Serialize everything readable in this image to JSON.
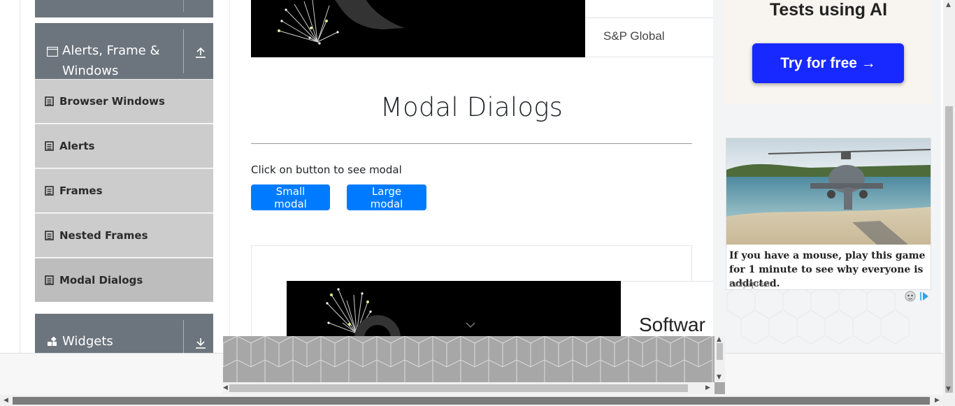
{
  "sidebar": {
    "group_alerts": {
      "title_line1": "Alerts, Frame &",
      "title_line2": "Windows",
      "icon": "window-icon",
      "toggle_icon": "arrow-up-icon"
    },
    "items": [
      {
        "label": "Browser Windows",
        "icon": "list-icon"
      },
      {
        "label": "Alerts",
        "icon": "list-icon"
      },
      {
        "label": "Frames",
        "icon": "list-icon"
      },
      {
        "label": "Nested Frames",
        "icon": "list-icon"
      },
      {
        "label": "Modal Dialogs",
        "icon": "list-icon",
        "active": true
      }
    ],
    "group_widgets": {
      "title": "Widgets",
      "icon": "widgets-icon",
      "toggle_icon": "arrow-down-icon"
    }
  },
  "banner_top": {
    "brand": "S&P Global"
  },
  "main": {
    "title": "Modal Dialogs",
    "instruction": "Click on button to see modal",
    "small_modal_label": "Small modal",
    "large_modal_label": "Large modal"
  },
  "banner_mid": {
    "text": "Softwar"
  },
  "right_ad": {
    "headline": "Tests using AI",
    "cta_label": "Try for free →",
    "ad_copy": "If you have a mouse, play this game for 1 minute to see why everyone is addicted.",
    "ad_source": "navy.quest"
  },
  "colors": {
    "primary": "#007bff",
    "sidebar_header": "#6c757d",
    "sidebar_item": "#cccccc",
    "cta": "#1729ff"
  }
}
